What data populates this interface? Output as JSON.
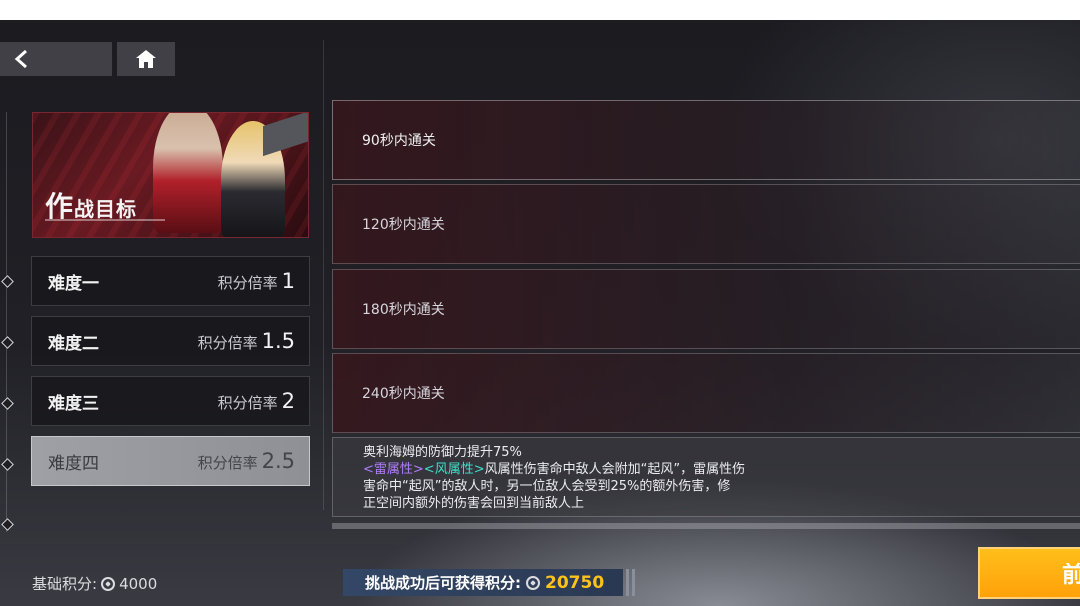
{
  "nav": {
    "back_icon": "back-arrow-icon",
    "home_icon": "home-icon"
  },
  "banner": {
    "title_first": "作",
    "title_rest": "战目标"
  },
  "difficulties": [
    {
      "name": "难度一",
      "rate_label": "积分倍率",
      "multiplier": "1",
      "selected": false
    },
    {
      "name": "难度二",
      "rate_label": "积分倍率",
      "multiplier": "1.5",
      "selected": false
    },
    {
      "name": "难度三",
      "rate_label": "积分倍率",
      "multiplier": "2",
      "selected": false
    },
    {
      "name": "难度四",
      "rate_label": "积分倍率",
      "multiplier": "2.5",
      "selected": true
    }
  ],
  "objectives": [
    "90秒内通关",
    "120秒内通关",
    "180秒内通关",
    "240秒内通关"
  ],
  "effect": {
    "line1": "奥利海姆的防御力提升75%",
    "tag_thunder": "<雷属性>",
    "tag_wind": "<风属性>",
    "line2_rest": "风属性伤害命中敌人会附加“起风”，雷属性伤",
    "line3": "害命中“起风”的敌人时，另一位敌人会受到25%的额外伤害，修",
    "line4": "正空间内额外的伤害会回到当前敌人上"
  },
  "footer": {
    "base_label": "基础积分:",
    "base_value": "4000",
    "reward_label": "挑战成功后可获得积分:",
    "reward_value": "20750",
    "start_label": "前"
  },
  "colors": {
    "accent": "#ffb215",
    "reward_value": "#ffc21a",
    "thunder": "#b27cff",
    "wind": "#3fe0c8"
  }
}
